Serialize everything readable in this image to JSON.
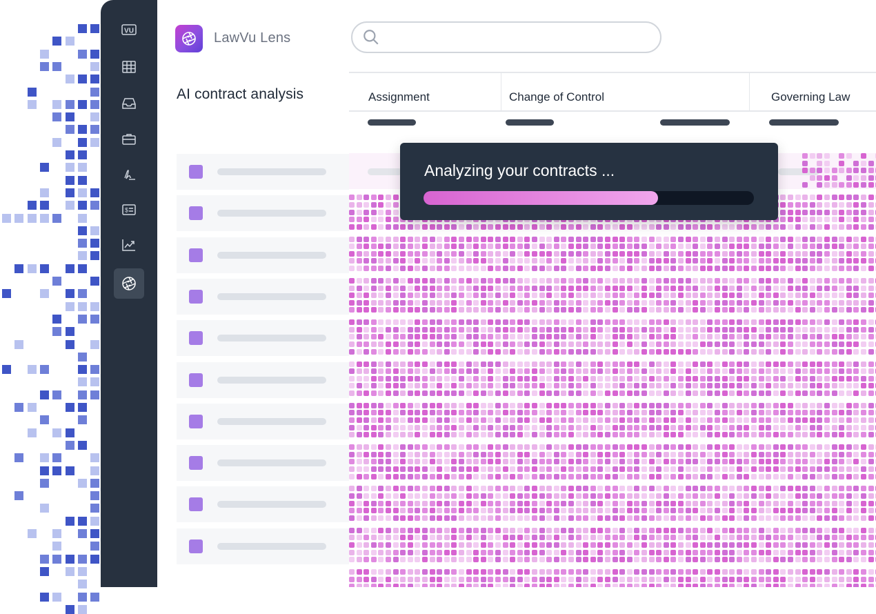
{
  "app": {
    "name": "LawVu Lens",
    "brand_mark": "VU"
  },
  "search": {
    "placeholder": ""
  },
  "page": {
    "title": "AI contract analysis"
  },
  "columns": [
    "Assignment",
    "Change of Control",
    "Governing Law"
  ],
  "sidebar": {
    "items": [
      {
        "icon": "lawvu-logo-icon"
      },
      {
        "icon": "grid-table-icon"
      },
      {
        "icon": "inbox-tray-icon"
      },
      {
        "icon": "briefcase-icon"
      },
      {
        "icon": "signature-icon"
      },
      {
        "icon": "invoice-dollar-icon"
      },
      {
        "icon": "analytics-chart-icon"
      },
      {
        "icon": "aperture-lens-icon",
        "active": true
      }
    ]
  },
  "overlay": {
    "message": "Analyzing your contracts ...",
    "progress": 0.71
  },
  "rows": 10,
  "colors": {
    "sidebar": "#27313f",
    "accent_pink": "#d764d1",
    "checkbox": "#a57ce6",
    "modal": "#263241",
    "pixel_blues": [
      "#3f55c6",
      "#6e7fd8",
      "#b8c2ef"
    ]
  }
}
